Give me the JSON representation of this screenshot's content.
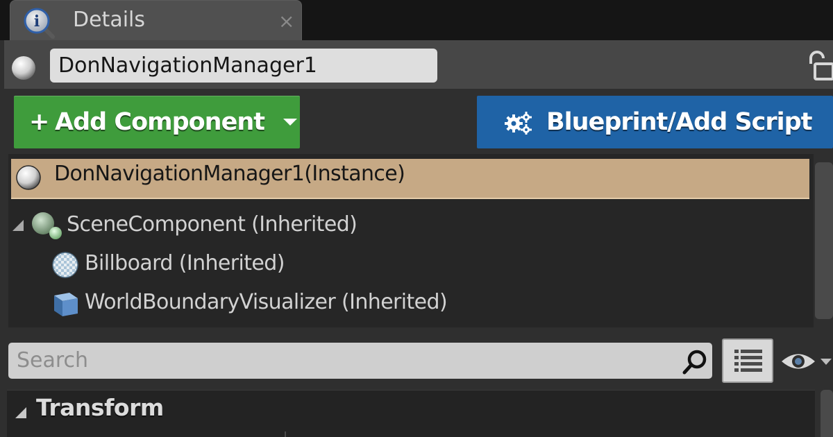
{
  "tab": {
    "title": "Details",
    "close_label": "×"
  },
  "actor": {
    "name": "DonNavigationManager1"
  },
  "toolbar": {
    "add_component_label": "Add Component",
    "add_component_icon": "+",
    "blueprint_label": "Blueprint/Add Script"
  },
  "components": {
    "instance_label": "DonNavigationManager1(Instance)",
    "items": [
      {
        "label": "SceneComponent (Inherited)",
        "icon": "scene-component-icon"
      },
      {
        "label": "Billboard (Inherited)",
        "icon": "billboard-icon"
      },
      {
        "label": "WorldBoundaryVisualizer (Inherited)",
        "icon": "cube-icon"
      }
    ]
  },
  "search": {
    "placeholder": "Search"
  },
  "sections": {
    "transform_label": "Transform"
  },
  "colors": {
    "add_button": "#3f9c3c",
    "blueprint_button": "#1f63a6",
    "selected_row": "#c6a985"
  }
}
